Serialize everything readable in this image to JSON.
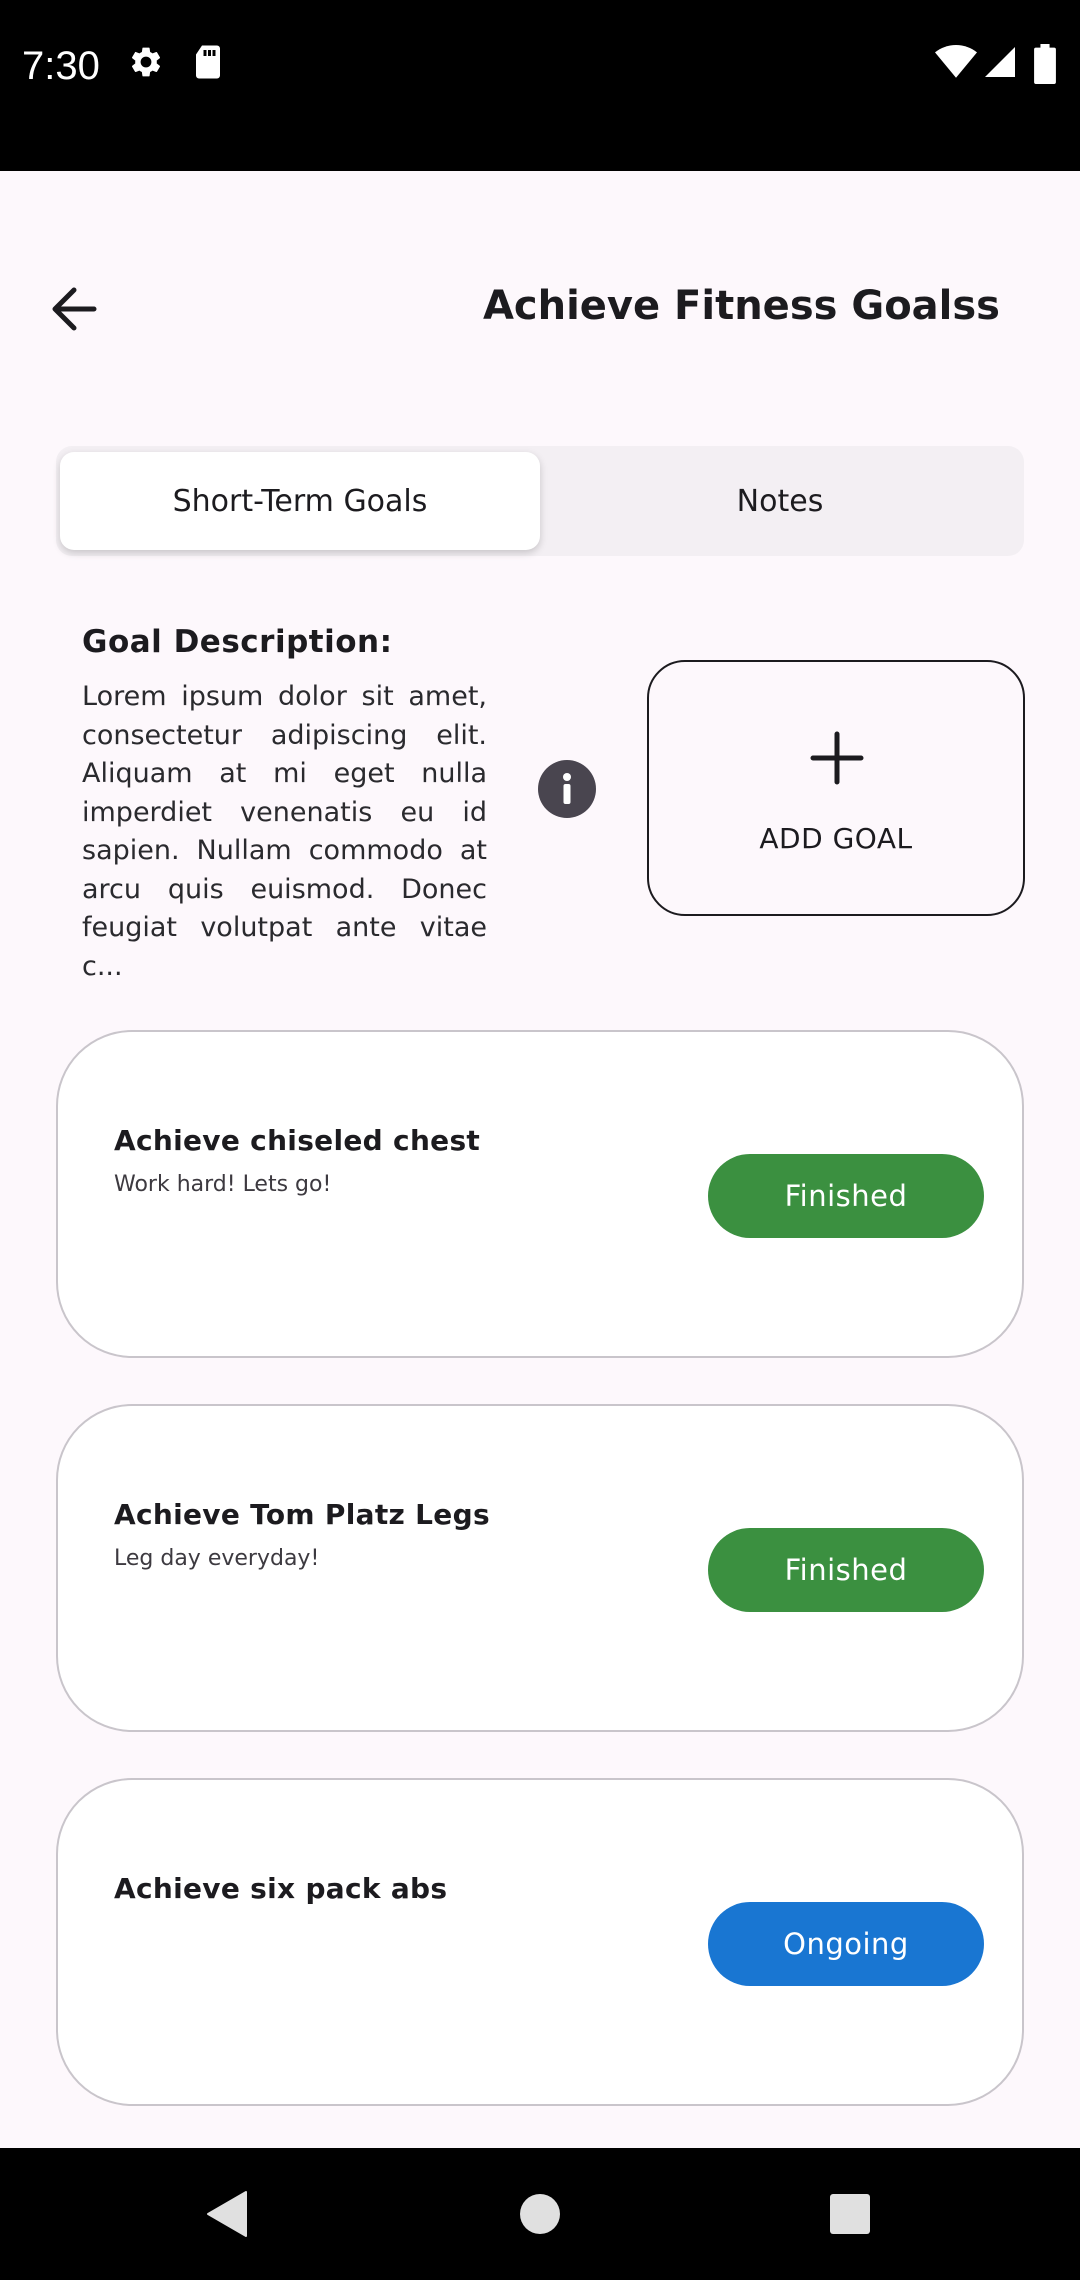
{
  "status_bar": {
    "time": "7:30",
    "icons": [
      "settings-gear-icon",
      "sd-card-icon",
      "wifi-icon",
      "cell-signal-icon",
      "battery-icon"
    ]
  },
  "header": {
    "title": "Achieve Fitness Goalss",
    "back_icon": "arrow-left-icon"
  },
  "tabs": [
    {
      "label": "Short-Term Goals",
      "selected": true
    },
    {
      "label": "Notes",
      "selected": false
    }
  ],
  "goal_description": {
    "heading": "Goal Description:",
    "text": "Lorem ipsum dolor sit amet, consectetur adipiscing elit. Aliquam at mi eget nulla imperdiet venenatis eu id sapien. Nullam commodo at arcu quis euismod. Donec feugiat volutpat ante vitae c...",
    "info_icon": "info-icon"
  },
  "add_goal": {
    "label": "ADD GOAL",
    "icon": "plus-icon"
  },
  "goals": [
    {
      "title": "Achieve chiseled chest",
      "subtitle": "Work hard! Lets go!",
      "status": "Finished",
      "status_color": "#3b9040"
    },
    {
      "title": "Achieve Tom Platz Legs",
      "subtitle": "Leg day everyday!",
      "status": "Finished",
      "status_color": "#3b9040"
    },
    {
      "title": "Achieve six pack abs",
      "subtitle": "",
      "status": "Ongoing",
      "status_color": "#1976d2"
    }
  ],
  "colors": {
    "finished": "#3b9040",
    "ongoing": "#1976d2",
    "background": "#fdf8fc"
  },
  "nav_bar": {
    "icons": [
      "back-triangle-icon",
      "home-circle-icon",
      "recents-square-icon"
    ]
  }
}
